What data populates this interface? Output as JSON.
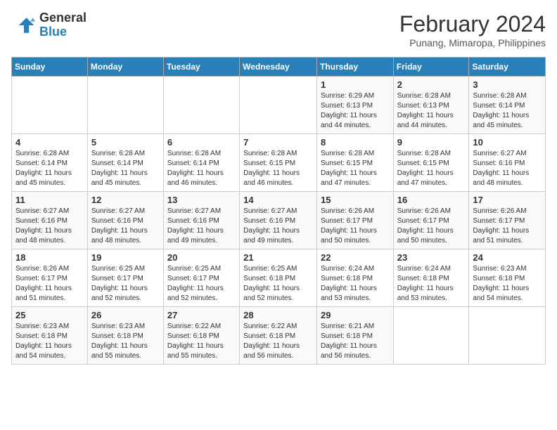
{
  "header": {
    "logo_line1": "General",
    "logo_line2": "Blue",
    "month_title": "February 2024",
    "location": "Punang, Mimaropa, Philippines"
  },
  "days_of_week": [
    "Sunday",
    "Monday",
    "Tuesday",
    "Wednesday",
    "Thursday",
    "Friday",
    "Saturday"
  ],
  "weeks": [
    [
      {
        "num": "",
        "info": ""
      },
      {
        "num": "",
        "info": ""
      },
      {
        "num": "",
        "info": ""
      },
      {
        "num": "",
        "info": ""
      },
      {
        "num": "1",
        "info": "Sunrise: 6:29 AM\nSunset: 6:13 PM\nDaylight: 11 hours and 44 minutes."
      },
      {
        "num": "2",
        "info": "Sunrise: 6:28 AM\nSunset: 6:13 PM\nDaylight: 11 hours and 44 minutes."
      },
      {
        "num": "3",
        "info": "Sunrise: 6:28 AM\nSunset: 6:14 PM\nDaylight: 11 hours and 45 minutes."
      }
    ],
    [
      {
        "num": "4",
        "info": "Sunrise: 6:28 AM\nSunset: 6:14 PM\nDaylight: 11 hours and 45 minutes."
      },
      {
        "num": "5",
        "info": "Sunrise: 6:28 AM\nSunset: 6:14 PM\nDaylight: 11 hours and 45 minutes."
      },
      {
        "num": "6",
        "info": "Sunrise: 6:28 AM\nSunset: 6:14 PM\nDaylight: 11 hours and 46 minutes."
      },
      {
        "num": "7",
        "info": "Sunrise: 6:28 AM\nSunset: 6:15 PM\nDaylight: 11 hours and 46 minutes."
      },
      {
        "num": "8",
        "info": "Sunrise: 6:28 AM\nSunset: 6:15 PM\nDaylight: 11 hours and 47 minutes."
      },
      {
        "num": "9",
        "info": "Sunrise: 6:28 AM\nSunset: 6:15 PM\nDaylight: 11 hours and 47 minutes."
      },
      {
        "num": "10",
        "info": "Sunrise: 6:27 AM\nSunset: 6:16 PM\nDaylight: 11 hours and 48 minutes."
      }
    ],
    [
      {
        "num": "11",
        "info": "Sunrise: 6:27 AM\nSunset: 6:16 PM\nDaylight: 11 hours and 48 minutes."
      },
      {
        "num": "12",
        "info": "Sunrise: 6:27 AM\nSunset: 6:16 PM\nDaylight: 11 hours and 48 minutes."
      },
      {
        "num": "13",
        "info": "Sunrise: 6:27 AM\nSunset: 6:16 PM\nDaylight: 11 hours and 49 minutes."
      },
      {
        "num": "14",
        "info": "Sunrise: 6:27 AM\nSunset: 6:16 PM\nDaylight: 11 hours and 49 minutes."
      },
      {
        "num": "15",
        "info": "Sunrise: 6:26 AM\nSunset: 6:17 PM\nDaylight: 11 hours and 50 minutes."
      },
      {
        "num": "16",
        "info": "Sunrise: 6:26 AM\nSunset: 6:17 PM\nDaylight: 11 hours and 50 minutes."
      },
      {
        "num": "17",
        "info": "Sunrise: 6:26 AM\nSunset: 6:17 PM\nDaylight: 11 hours and 51 minutes."
      }
    ],
    [
      {
        "num": "18",
        "info": "Sunrise: 6:26 AM\nSunset: 6:17 PM\nDaylight: 11 hours and 51 minutes."
      },
      {
        "num": "19",
        "info": "Sunrise: 6:25 AM\nSunset: 6:17 PM\nDaylight: 11 hours and 52 minutes."
      },
      {
        "num": "20",
        "info": "Sunrise: 6:25 AM\nSunset: 6:17 PM\nDaylight: 11 hours and 52 minutes."
      },
      {
        "num": "21",
        "info": "Sunrise: 6:25 AM\nSunset: 6:18 PM\nDaylight: 11 hours and 52 minutes."
      },
      {
        "num": "22",
        "info": "Sunrise: 6:24 AM\nSunset: 6:18 PM\nDaylight: 11 hours and 53 minutes."
      },
      {
        "num": "23",
        "info": "Sunrise: 6:24 AM\nSunset: 6:18 PM\nDaylight: 11 hours and 53 minutes."
      },
      {
        "num": "24",
        "info": "Sunrise: 6:23 AM\nSunset: 6:18 PM\nDaylight: 11 hours and 54 minutes."
      }
    ],
    [
      {
        "num": "25",
        "info": "Sunrise: 6:23 AM\nSunset: 6:18 PM\nDaylight: 11 hours and 54 minutes."
      },
      {
        "num": "26",
        "info": "Sunrise: 6:23 AM\nSunset: 6:18 PM\nDaylight: 11 hours and 55 minutes."
      },
      {
        "num": "27",
        "info": "Sunrise: 6:22 AM\nSunset: 6:18 PM\nDaylight: 11 hours and 55 minutes."
      },
      {
        "num": "28",
        "info": "Sunrise: 6:22 AM\nSunset: 6:18 PM\nDaylight: 11 hours and 56 minutes."
      },
      {
        "num": "29",
        "info": "Sunrise: 6:21 AM\nSunset: 6:18 PM\nDaylight: 11 hours and 56 minutes."
      },
      {
        "num": "",
        "info": ""
      },
      {
        "num": "",
        "info": ""
      }
    ]
  ]
}
